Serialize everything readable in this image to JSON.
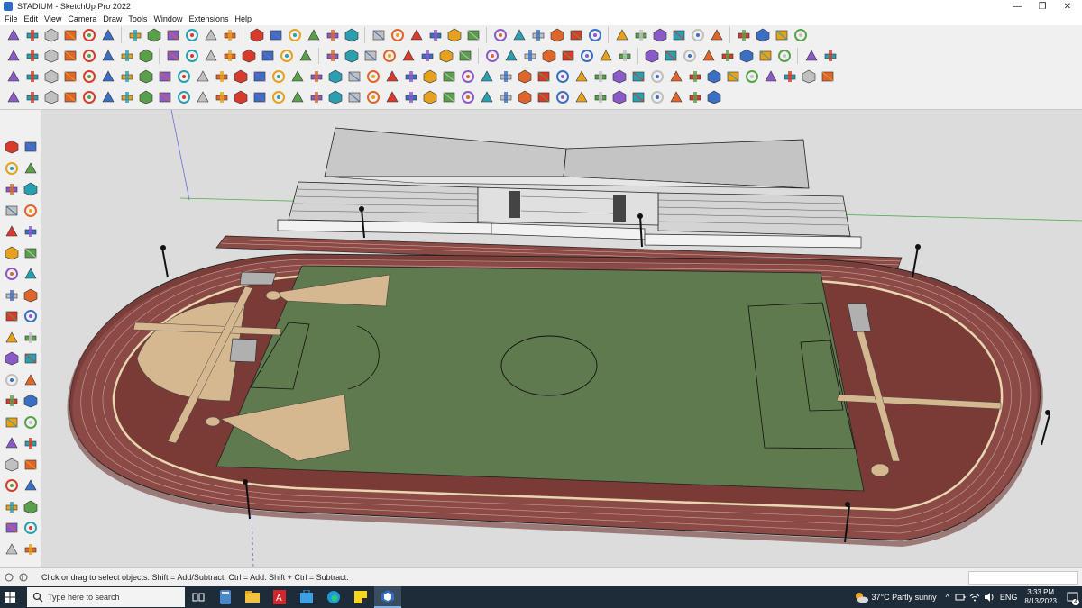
{
  "window": {
    "title": "STADIUM - SketchUp Pro 2022",
    "minimize": "—",
    "restore": "❐",
    "close": "✕"
  },
  "menu": [
    "File",
    "Edit",
    "View",
    "Camera",
    "Draw",
    "Tools",
    "Window",
    "Extensions",
    "Help"
  ],
  "statusbar": {
    "hint": "Click or drag to select objects. Shift = Add/Subtract. Ctrl = Add. Shift + Ctrl = Subtract."
  },
  "taskbar": {
    "search_placeholder": "Type here to search",
    "weather": "37°C  Partly sunny",
    "language": "ENG",
    "time": "3:33 PM",
    "date": "8/13/2023",
    "notifications": "4"
  },
  "colors": {
    "track": "#8b4a45",
    "track_dark": "#6e3733",
    "infield_dirt": "#7a3b37",
    "grass": "#5f7a4e",
    "sand": "#d6b890",
    "lane_line": "#e8d6b0",
    "viewport_bg": "#dcdcdc",
    "taskbar": "#1e2b38"
  }
}
